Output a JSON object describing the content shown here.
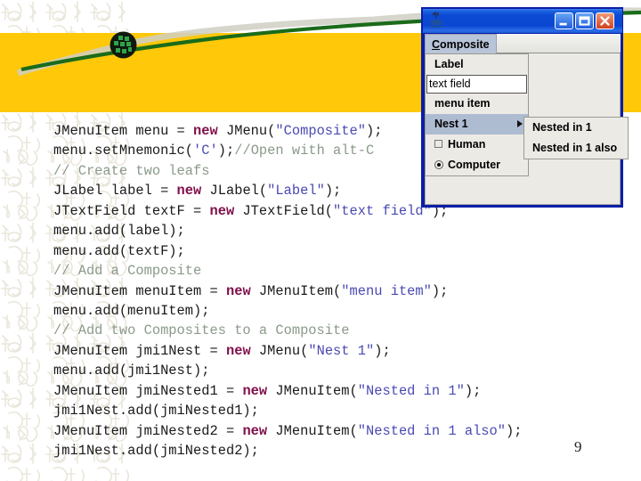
{
  "slide": {
    "page_number": "9",
    "band_color": "#FFC808",
    "swoosh_color": "#1a6b1a"
  },
  "code": {
    "lines": [
      [
        {
          "t": "JMenuItem menu = ",
          "c": "plain"
        },
        {
          "t": "new",
          "c": "kw"
        },
        {
          "t": " JMenu(",
          "c": "plain"
        },
        {
          "t": "\"Composite\"",
          "c": "str"
        },
        {
          "t": ");",
          "c": "plain"
        }
      ],
      [
        {
          "t": "menu.setMnemonic(",
          "c": "plain"
        },
        {
          "t": "'C'",
          "c": "str"
        },
        {
          "t": ");",
          "c": "plain"
        },
        {
          "t": "//Open with alt-C",
          "c": "cmt"
        }
      ],
      [
        {
          "t": "// Create two leafs",
          "c": "cmt"
        }
      ],
      [
        {
          "t": "JLabel label = ",
          "c": "plain"
        },
        {
          "t": "new",
          "c": "kw"
        },
        {
          "t": " JLabel(",
          "c": "plain"
        },
        {
          "t": "\"Label\"",
          "c": "str"
        },
        {
          "t": ");",
          "c": "plain"
        }
      ],
      [
        {
          "t": "JTextField textF = ",
          "c": "plain"
        },
        {
          "t": "new",
          "c": "kw"
        },
        {
          "t": " JTextField(",
          "c": "plain"
        },
        {
          "t": "\"text field\"",
          "c": "str"
        },
        {
          "t": ");",
          "c": "plain"
        }
      ],
      [
        {
          "t": "menu.add(label);",
          "c": "plain"
        }
      ],
      [
        {
          "t": "menu.add(textF);",
          "c": "plain"
        }
      ],
      [
        {
          "t": "// Add a Composite",
          "c": "cmt"
        }
      ],
      [
        {
          "t": "JMenuItem menuItem = ",
          "c": "plain"
        },
        {
          "t": "new",
          "c": "kw"
        },
        {
          "t": " JMenuItem(",
          "c": "plain"
        },
        {
          "t": "\"menu item\"",
          "c": "str"
        },
        {
          "t": ");",
          "c": "plain"
        }
      ],
      [
        {
          "t": "menu.add(menuItem);",
          "c": "plain"
        }
      ],
      [
        {
          "t": "// Add two Composites to a Composite",
          "c": "cmt"
        }
      ],
      [
        {
          "t": "JMenuItem jmi1Nest = ",
          "c": "plain"
        },
        {
          "t": "new",
          "c": "kw"
        },
        {
          "t": " JMenu(",
          "c": "plain"
        },
        {
          "t": "\"Nest 1\"",
          "c": "str"
        },
        {
          "t": ");",
          "c": "plain"
        }
      ],
      [
        {
          "t": "menu.add(jmi1Nest);",
          "c": "plain"
        }
      ],
      [
        {
          "t": "JMenuItem jmiNested1 = ",
          "c": "plain"
        },
        {
          "t": "new",
          "c": "kw"
        },
        {
          "t": " JMenuItem(",
          "c": "plain"
        },
        {
          "t": "\"Nested in 1\"",
          "c": "str"
        },
        {
          "t": ");",
          "c": "plain"
        }
      ],
      [
        {
          "t": "jmi1Nest.add(jmiNested1);",
          "c": "plain"
        }
      ],
      [
        {
          "t": "JMenuItem jmiNested2 = ",
          "c": "plain"
        },
        {
          "t": "new",
          "c": "kw"
        },
        {
          "t": " JMenuItem(",
          "c": "plain"
        },
        {
          "t": "\"Nested in 1 also\"",
          "c": "str"
        },
        {
          "t": ");",
          "c": "plain"
        }
      ],
      [
        {
          "t": "jmi1Nest.add(jmiNested2);",
          "c": "plain"
        }
      ]
    ]
  },
  "window": {
    "title": "",
    "icon": "java-coffee-cup-icon",
    "buttons": {
      "minimize": "minimize-icon",
      "maximize": "maximize-icon",
      "close": "close-icon"
    },
    "menubar": {
      "composite": {
        "mnemonic": "C",
        "rest": "omposite"
      }
    },
    "popup": {
      "items": [
        {
          "label": "Label",
          "type": "label"
        },
        {
          "label": "text field",
          "type": "textfield"
        },
        {
          "label": "menu item",
          "type": "item"
        },
        {
          "label": "Nest 1",
          "type": "submenu",
          "selected": true
        },
        {
          "label": "Human",
          "type": "checkbox",
          "checked": false
        },
        {
          "label": "Computer",
          "type": "radio",
          "checked": true
        }
      ]
    },
    "submenu": {
      "items": [
        {
          "label": "Nested in 1"
        },
        {
          "label": "Nested in 1 also"
        }
      ]
    }
  }
}
